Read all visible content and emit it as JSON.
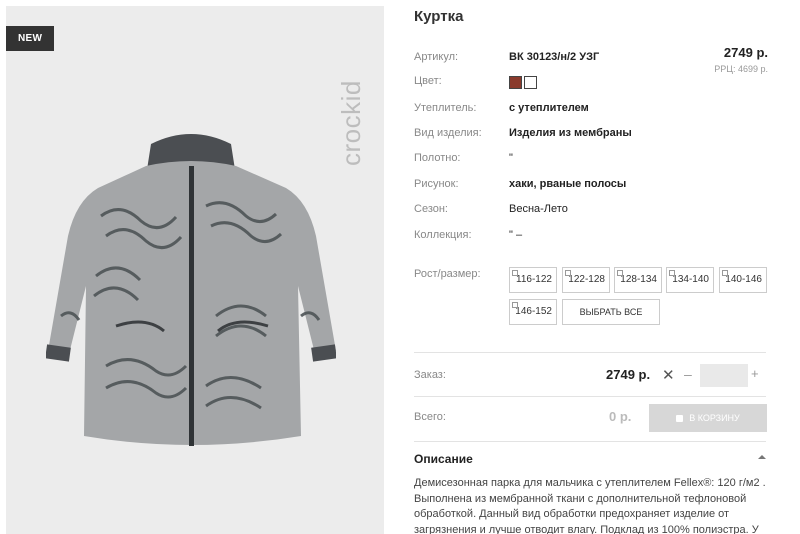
{
  "product": {
    "badge": "NEW",
    "brand_logo": "crockid",
    "title": "Куртка"
  },
  "specs": {
    "article_label": "Артикул:",
    "article_value": "ВК 30123/н/2 УЗГ",
    "color_label": "Цвет:",
    "swatches": [
      {
        "name": "brown",
        "hex": "#8a3a2c"
      },
      {
        "name": "white",
        "hex": "#ffffff"
      }
    ],
    "insulation_label": "Утеплитель:",
    "insulation_value": "с утеплителем",
    "type_label": "Вид изделия:",
    "type_value": "Изделия из мембраны",
    "fabric_label": "Полотно:",
    "fabric_value": "\"",
    "pattern_label": "Рисунок:",
    "pattern_value": "хаки, рваные полосы",
    "season_label": "Сезон:",
    "season_value": "Весна-Лето",
    "collection_label": "Коллекция:",
    "collection_value": "\" –",
    "size_label": "Рост/размер:"
  },
  "price": {
    "main": "2749 р.",
    "rrp": "РРЦ: 4699 р."
  },
  "sizes": [
    "116-122",
    "122-128",
    "128-134",
    "134-140",
    "140-146",
    "146-152"
  ],
  "select_all_label": "ВЫБРАТЬ ВСЕ",
  "order": {
    "label": "Заказ:",
    "price": "2749 р.",
    "times": "✕",
    "minus": "–",
    "plus": "+",
    "quantity": ""
  },
  "total": {
    "label": "Всего:",
    "value": "0 р.",
    "cart_button": "В КОРЗИНУ"
  },
  "description": {
    "heading": "Описание",
    "text": "Демисезонная парка для мальчика с утеплителем Fellex®: 120 г/м2 . Выполнена из мембранной ткани с дополнительной тефлоновой обработкой. Данный вид обработки предохраняет изделие от загрязнения и лучше отводит влагу. Подклад из 100% полиэстра. У"
  },
  "colors": {
    "panel_bg": "#ececec",
    "badge_bg": "#333333",
    "cart_button_bg": "#d7d7d7"
  }
}
